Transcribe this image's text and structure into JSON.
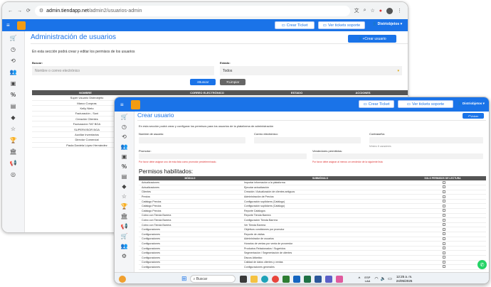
{
  "browser": {
    "url": "admin.tiendapp.net/admin2/usuarios-admin",
    "url_host": "admin.tiendapp.net",
    "url_path": "/admin2/usuarios-admin"
  },
  "back": {
    "user_label": "Distriobjetos",
    "crear_ticket": "Crear Ticket",
    "ver_tickets": "Ver tickets soporte",
    "title": "Administración de usuarios",
    "crear_usuario": "Crear usuario",
    "description": "En esta sección podrá crear y editar los permisos de los usuarios",
    "buscar_label": "Buscar:",
    "buscar_placeholder": "Nombre o correo electrónico",
    "estado_label": "Estado:",
    "estado_value": "Todos",
    "buscar_btn": "Buscar",
    "limpiar_btn": "Limpiar",
    "columns": [
      "NOMBRE",
      "CORREO ELECTRÓNICO",
      "ESTADO",
      "ACCIONES"
    ],
    "rows": [
      "Super Usuario Distriobjeto",
      "Marco Conpras",
      "Kelly Nieto",
      "Facturación - Soni",
      "Creación Clientes",
      "Facturación TAT BGA",
      "SUPERVISOR BGA",
      "Auxiliar Inventarios",
      "Director Comercial",
      "Paula Daniela López Hernández"
    ]
  },
  "front": {
    "crear_ticket": "Crear Ticket",
    "ver_tickets": "Ver tickets soporte",
    "user_label": "Distriobjetos",
    "title": "Crear usuario",
    "volver": "Volver",
    "description": "En esta sección podrá crear y configurar los permisos para los usuarios de la plataforma de administración",
    "nombre_label": "Nombre de usuario:",
    "correo_label": "Correo electrónico:",
    "contrasena_label": "Contraseña:",
    "contrasena_hint": "Mínimo 8 caracteres",
    "promotor_label": "Promotor:",
    "vendedores_label": "Vendedores permitidos:",
    "promotor_err": "Por favor debe asignar uno de esta lista como promotor predeterminado.",
    "vendedores_err": "Por favor debe asignar al menos un vendedor de la siguiente lista",
    "permisos_title": "Permisos habilitados:",
    "columns": [
      "MÓDULO",
      "SUBMÓDULO",
      "SOLO PERMISOS DE LECTURA"
    ],
    "rows": [
      [
        "Actualizaciones",
        "Importar información a la plataforma"
      ],
      [
        "Actualizaciones",
        "Ejecutar actualización"
      ],
      [
        "Clientes",
        "Creación / Actualización de clientes antiguos"
      ],
      [
        "Precios",
        "Administración de Precios"
      ],
      [
        "Catálogo Precios",
        "Configuración suplidores (Catálogo)"
      ],
      [
        "Catálogo Precios",
        "Configuración suplidores (Catálogo)"
      ],
      [
        "Catálogo Precios",
        "Reporte Catálogos"
      ],
      [
        "Cobro con Tienda Barrera",
        "Reporte Tienda Barrera"
      ],
      [
        "Cobro con Tienda Barrera",
        "Configuración Tienda Barrera"
      ],
      [
        "Cobro con Tienda Barrera",
        "Ver Tienda Barrera"
      ],
      [
        "Configuraciones",
        "Objetivos condiciones por promotor"
      ],
      [
        "Configuraciones",
        "Reporte de visitas"
      ],
      [
        "Configuraciones",
        "Administrador de usuarios"
      ],
      [
        "Configuraciones",
        "Horarios de ventas por venta de proveedor"
      ],
      [
        "Configuraciones",
        "Productos Relacionados / Sugeridos"
      ],
      [
        "Configuraciones",
        "Segmentación / Segmentación de clientes"
      ],
      [
        "Configuraciones",
        "Discos Atlántico"
      ],
      [
        "Configuraciones",
        "Calidad de datos clientes y ventas"
      ],
      [
        "Configuraciones",
        "Configuraciones generales"
      ]
    ]
  },
  "taskbar": {
    "search_placeholder": "Buscar",
    "lang": "ESP",
    "lang2": "LAA",
    "time": "12:25 a. m.",
    "date": "24/05/2025"
  },
  "colors": {
    "accent": "#1a73e8",
    "header_dark": "#555555",
    "error": "#dd3333"
  }
}
